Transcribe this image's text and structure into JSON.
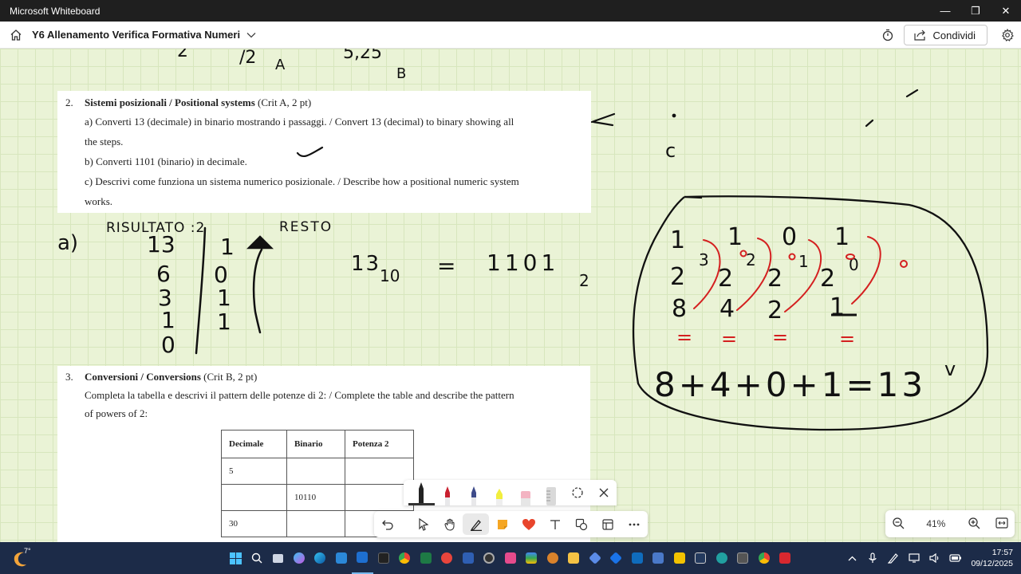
{
  "window": {
    "title": "Microsoft Whiteboard",
    "minimize": "—",
    "maximize": "❐",
    "close": "✕"
  },
  "header": {
    "board_title": "Y6 Allenamento Verifica Formativa Numeri",
    "share_label": "Condividi"
  },
  "question2": {
    "number": "2.",
    "title": "Sistemi posizionali / Positional systems",
    "crit": " (Crit A, 2 pt)",
    "a1": "a) Converti 13 (decimale) in binario mostrando i passaggi. / Convert 13 (decimal) to binary showing all",
    "a2": "the steps.",
    "b": "b) Converti 1101 (binario) in decimale.",
    "c1": "c) Descrivi come funziona un sistema numerico posizionale. / Describe how a positional numeric system",
    "c2": "works."
  },
  "question3": {
    "number": "3.",
    "title": "Conversioni / Conversions",
    "crit": " (Crit B, 2 pt)",
    "line1": "Completa la tabella e descrivi il pattern delle potenze di 2: / Complete the table and describe the pattern",
    "line2": "of powers of 2:",
    "table": {
      "headers": [
        "Decimale",
        "Binario",
        "Potenza 2"
      ],
      "rows": [
        [
          "5",
          "",
          ""
        ],
        [
          "",
          "10110",
          ""
        ],
        [
          "30",
          "",
          ""
        ]
      ]
    }
  },
  "ink": {
    "top_fragment_1": "2",
    "top_fragment_2": "/2",
    "top_fragment_3": "A",
    "top_fragment_4": "5,25",
    "top_fragment_5": "B",
    "label_risultato": "RISULTATO :2",
    "label_resto": "RESTO",
    "label_a": "a)",
    "quotients": [
      "13",
      "6",
      "3",
      "1",
      "0"
    ],
    "remainders": [
      "1",
      "0",
      "1",
      "1"
    ],
    "equation_left": "13",
    "equation_left_sub": "10",
    "equation_eq": "=",
    "equation_right": "1101",
    "equation_right_sub": "2",
    "mark_c": "c",
    "bits": [
      "1",
      "1",
      "0",
      "1"
    ],
    "powers_base": [
      "2",
      "2",
      "2",
      "2"
    ],
    "powers_exp": [
      "3",
      "2",
      "1",
      "0"
    ],
    "values": [
      "8",
      "4",
      "2",
      "1"
    ],
    "eq_marks": [
      "=",
      "=",
      "=",
      "="
    ],
    "sum": "8+4+0+1=13",
    "check": "v"
  },
  "zoom": {
    "level": "41%"
  },
  "taskbar": {
    "temperature": "7°",
    "time": "17:57",
    "date": "09/12/2025"
  },
  "colors": {
    "ink_black": "#111111",
    "ink_red": "#d42020",
    "canvas": "#eaf3d6",
    "grid": "#d7e6bd",
    "taskbar": "#1c2b48"
  }
}
